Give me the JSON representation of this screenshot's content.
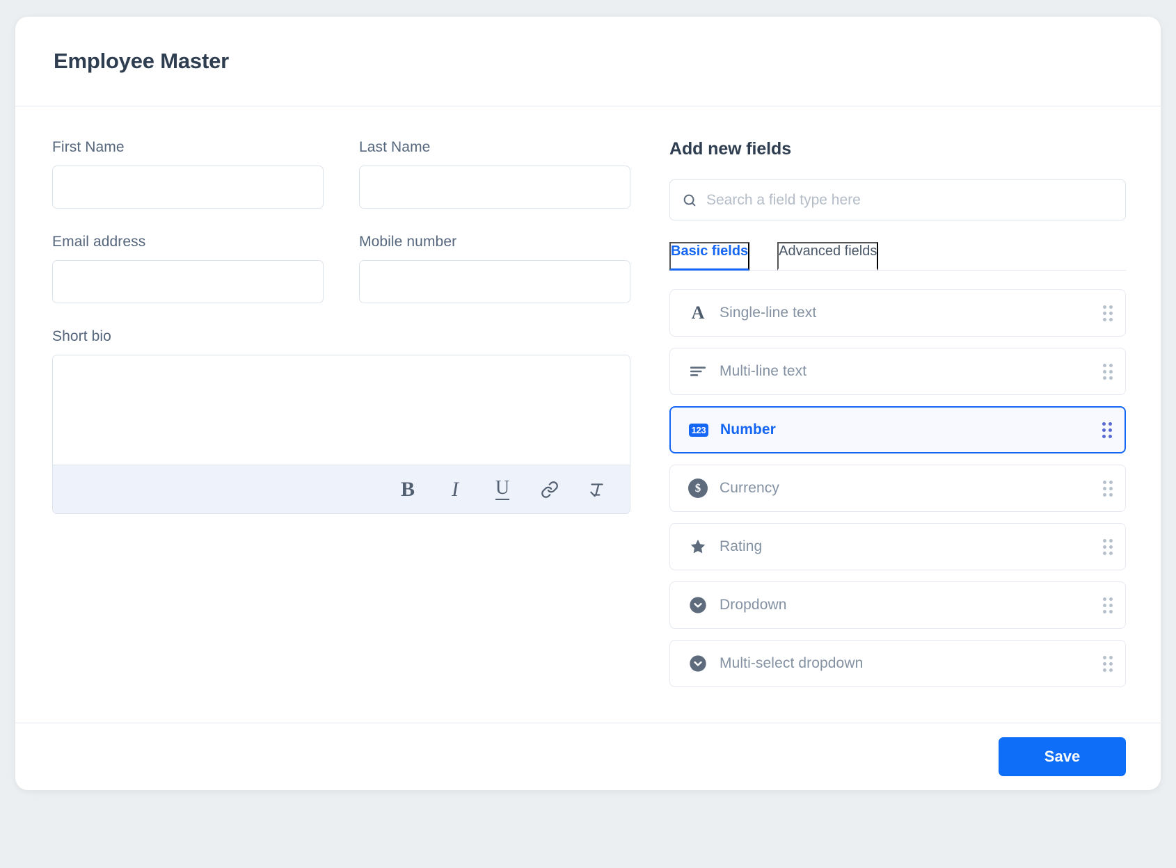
{
  "window": {
    "title": "Employee Master"
  },
  "form": {
    "fields": [
      {
        "label": "First Name",
        "value": "",
        "placeholder": "",
        "type": "text"
      },
      {
        "label": "Last Name",
        "value": "",
        "placeholder": "",
        "type": "text"
      },
      {
        "label": "Email address",
        "value": "",
        "placeholder": "",
        "type": "text"
      },
      {
        "label": "Mobile number",
        "value": "",
        "placeholder": "",
        "type": "text"
      },
      {
        "label": "Short bio",
        "value": "",
        "placeholder": "",
        "type": "richtext"
      }
    ],
    "editor_toolbar": [
      {
        "name": "bold-icon",
        "glyph": "B"
      },
      {
        "name": "italic-icon",
        "glyph": "I"
      },
      {
        "name": "underline-icon",
        "glyph": "U"
      },
      {
        "name": "link-icon",
        "glyph": "link"
      },
      {
        "name": "clear-formatting-icon",
        "glyph": "clear-format"
      }
    ]
  },
  "fields_panel": {
    "title": "Add new fields",
    "search": {
      "placeholder": "Search a field type here",
      "value": "",
      "icon": "search-icon"
    },
    "tabs": [
      {
        "label": "Basic fields",
        "active": true
      },
      {
        "label": "Advanced fields",
        "active": false
      }
    ],
    "field_types": [
      {
        "label": "Single-line text",
        "icon": "letter-a-icon",
        "selected": false
      },
      {
        "label": "Multi-line text",
        "icon": "lines-icon",
        "selected": false
      },
      {
        "label": "Number",
        "icon": "number-123-icon",
        "selected": true
      },
      {
        "label": "Currency",
        "icon": "dollar-circle-icon",
        "selected": false
      },
      {
        "label": "Rating",
        "icon": "star-icon",
        "selected": false
      },
      {
        "label": "Dropdown",
        "icon": "chevron-down-circle-icon",
        "selected": false
      },
      {
        "label": "Multi-select dropdown",
        "icon": "chevron-down-circle-icon",
        "selected": false
      }
    ],
    "drag_handle_icon": "drag-handle-icon"
  },
  "footer": {
    "save_label": "Save"
  },
  "colors": {
    "accent": "#1566f2",
    "save_button": "#0f6ef7",
    "title_text": "#2e3d4f",
    "label_text": "#55667c",
    "muted_text": "#8391a2",
    "border": "#e4e9ef",
    "toolbar_bg": "#eef2fa",
    "page_bg": "#eceff1"
  }
}
